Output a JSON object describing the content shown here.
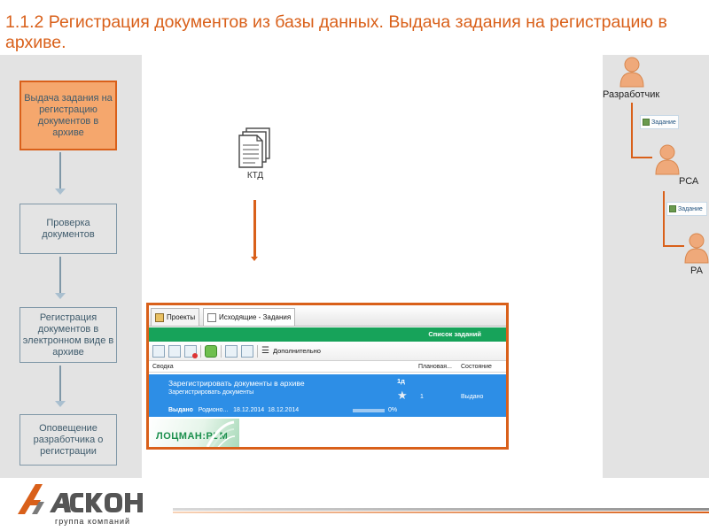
{
  "title": "1.1.2 Регистрация документов из базы данных. Выдача задания на регистрацию в архиве.",
  "steps": [
    {
      "label": "Выдача задания на регистрацию документов в архиве",
      "active": true
    },
    {
      "label": "Проверка документов",
      "active": false
    },
    {
      "label": "Регистрация документов в электронном виде в архиве",
      "active": false
    },
    {
      "label": "Оповещение разработчика о регистрации",
      "active": false
    }
  ],
  "ktd": {
    "label": "КТД"
  },
  "roles": {
    "developer": "Разработчик",
    "rsa": "РСА",
    "ra": "РА"
  },
  "chips": {
    "chip1": "Задание",
    "chip2": "Задание"
  },
  "app": {
    "tabs": [
      {
        "label": "Проекты",
        "icon": "folder-icon"
      },
      {
        "label": "Исходящие - Задания",
        "icon": "document-icon"
      }
    ],
    "task_list_title": "Список заданий",
    "more_label": "Дополнительно",
    "columns": {
      "summary": "Сводка",
      "planned": "Плановая...",
      "state": "Состояние"
    },
    "task": {
      "title": "Зарегистрировать документы в архиве",
      "subtitle": "Зарегистрировать документы",
      "status_bold": "Выдано",
      "author": "Родионо...",
      "date_start": "18.12.2014",
      "date_end": "18.12.2014",
      "progress_percent": 0,
      "progress_label": "0%",
      "days": "1д",
      "count": "1",
      "state": "Выдано"
    },
    "logo_text": "ЛОЦМАН:PLM"
  },
  "footer": {
    "brand": "АСКОН",
    "subtitle": "группа компаний"
  },
  "colors": {
    "accent": "#d9601a",
    "step_border": "#7f97a7",
    "step_text": "#3f5b6c",
    "active_fill": "#f5a76d",
    "task_blue": "#2d8ee6",
    "green_bar": "#17a35a"
  }
}
